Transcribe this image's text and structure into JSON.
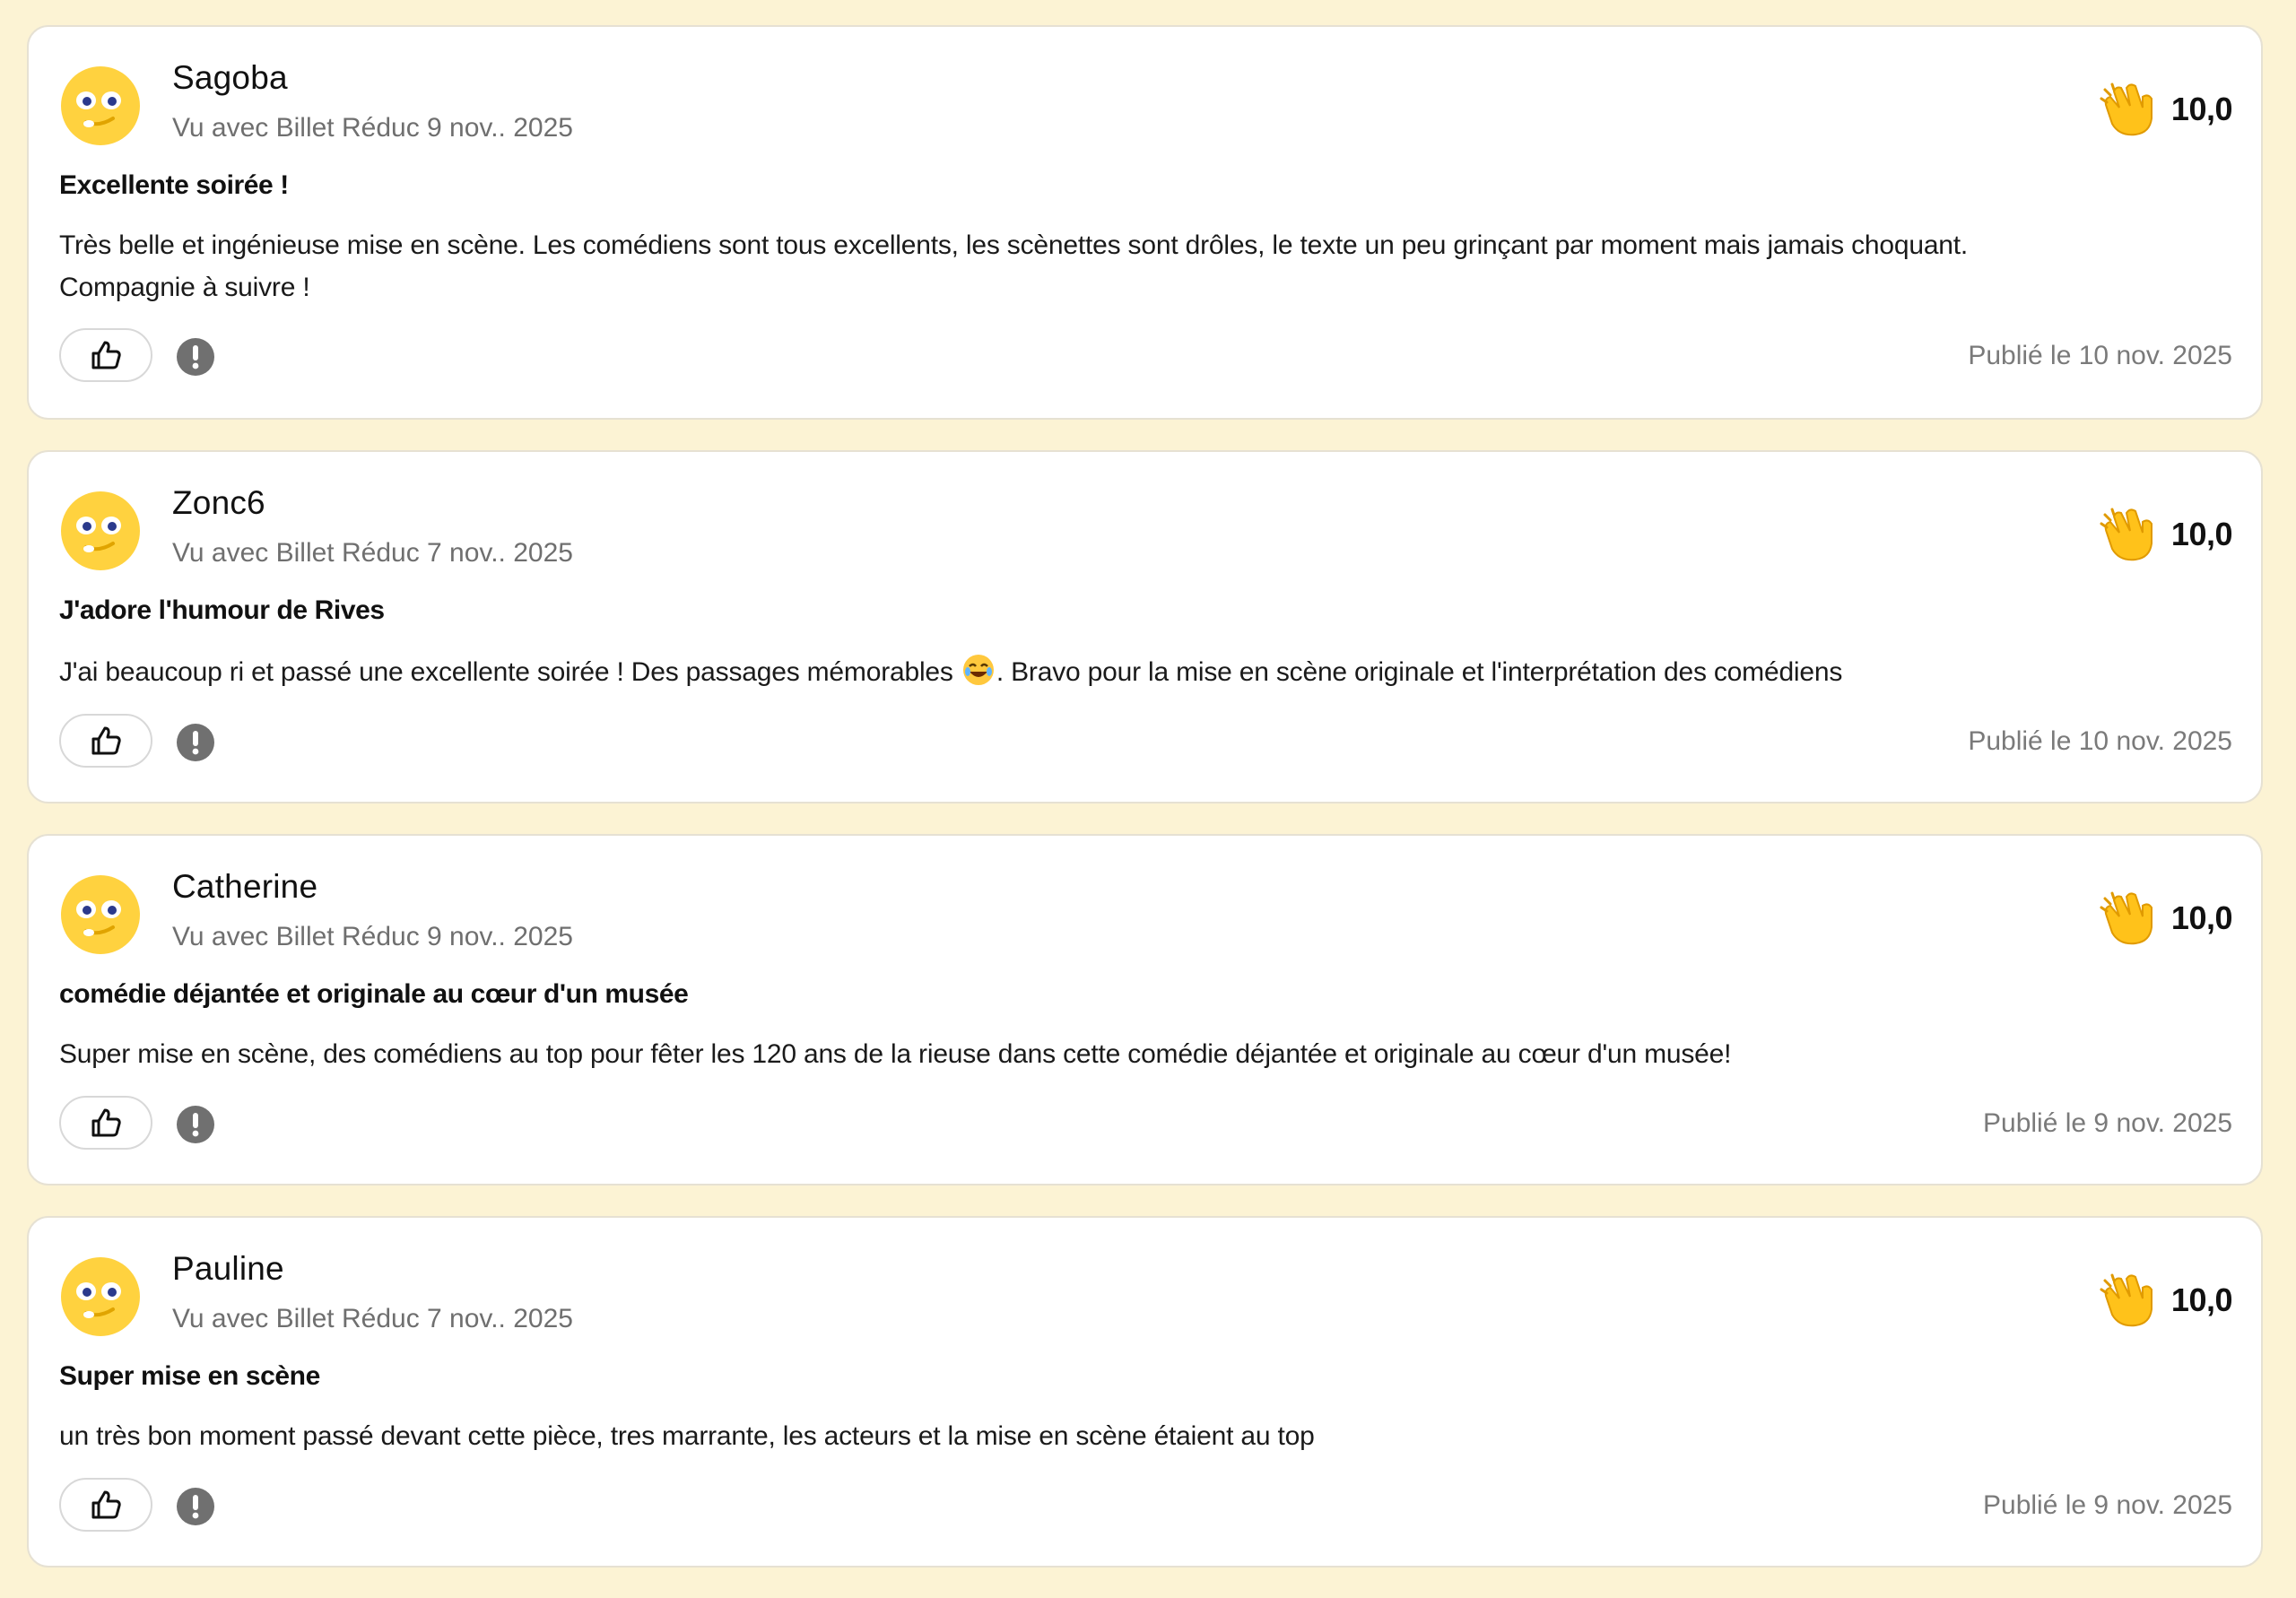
{
  "colors": {
    "background": "#fcf3d4",
    "avatar": "#ffd23f",
    "clap": "#ffc21a",
    "muted": "#6f6f6f"
  },
  "reviews": [
    {
      "author": "Sagoba",
      "meta": "Vu avec Billet Réduc 9 nov.. 2025",
      "score": "10,0",
      "title": "Excellente soirée !",
      "body_lines": [
        "Très belle et ingénieuse mise en scène. Les comédiens sont tous excellents, les scènettes sont drôles, le texte un peu grinçant par moment mais jamais choquant.",
        "Compagnie à suivre !"
      ],
      "published": "Publié le 10 nov. 2025"
    },
    {
      "author": "Zonc6",
      "meta": "Vu avec Billet Réduc 7 nov.. 2025",
      "score": "10,0",
      "title": "J'adore l'humour de Rives",
      "body_before_emoji": "J'ai beaucoup ri et passé une excellente soirée ! Des passages mémorables ",
      "body_emoji": "laughing-face-icon",
      "body_after_emoji": ". Bravo pour la mise en scène originale et l'interprétation des comédiens",
      "published": "Publié le 10 nov. 2025"
    },
    {
      "author": "Catherine",
      "meta": "Vu avec Billet Réduc 9 nov.. 2025",
      "score": "10,0",
      "title": "comédie déjantée et originale au cœur d'un musée",
      "body": "Super mise en scène, des comédiens au top pour fêter les 120 ans de la rieuse dans cette comédie déjantée et originale au cœur d'un musée!",
      "published": "Publié le 9 nov. 2025"
    },
    {
      "author": "Pauline",
      "meta": "Vu avec Billet Réduc 7 nov.. 2025",
      "score": "10,0",
      "title": "Super mise en scène",
      "body": "un très bon moment passé devant cette pièce, tres marrante, les acteurs et la mise en scène étaient au top",
      "published": "Publié le 9 nov. 2025"
    }
  ],
  "icons": {
    "avatar": "winking-face-avatar-icon",
    "rating": "clapping-hands-icon",
    "like": "thumbs-up-icon",
    "report": "exclamation-circle-icon"
  }
}
